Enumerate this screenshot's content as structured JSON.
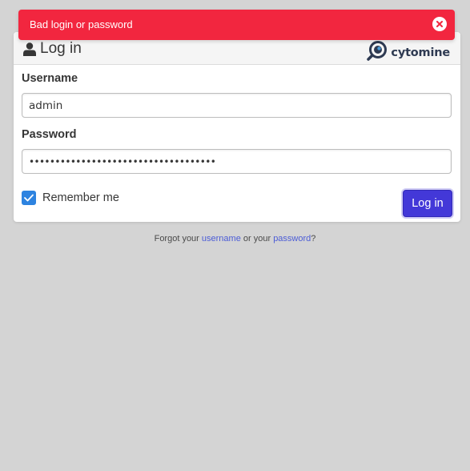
{
  "notification": {
    "message": "Bad login or password",
    "close_icon": "close-icon",
    "color": "#f2263f"
  },
  "login": {
    "title": "Log in",
    "title_icon": "user-icon",
    "logo_text": "cytomine",
    "username_label": "Username",
    "username_value": "admin",
    "password_label": "Password",
    "password_value": "••••••••••••••••••••••••••••••••••••",
    "remember_label": "Remember me",
    "remember_checked": true,
    "submit_label": "Log in",
    "accent_color": "#4338d8"
  },
  "forgot": {
    "prefix": "Forgot your ",
    "username_link": "username",
    "middle": " or your ",
    "password_link": "password",
    "suffix": "?"
  }
}
